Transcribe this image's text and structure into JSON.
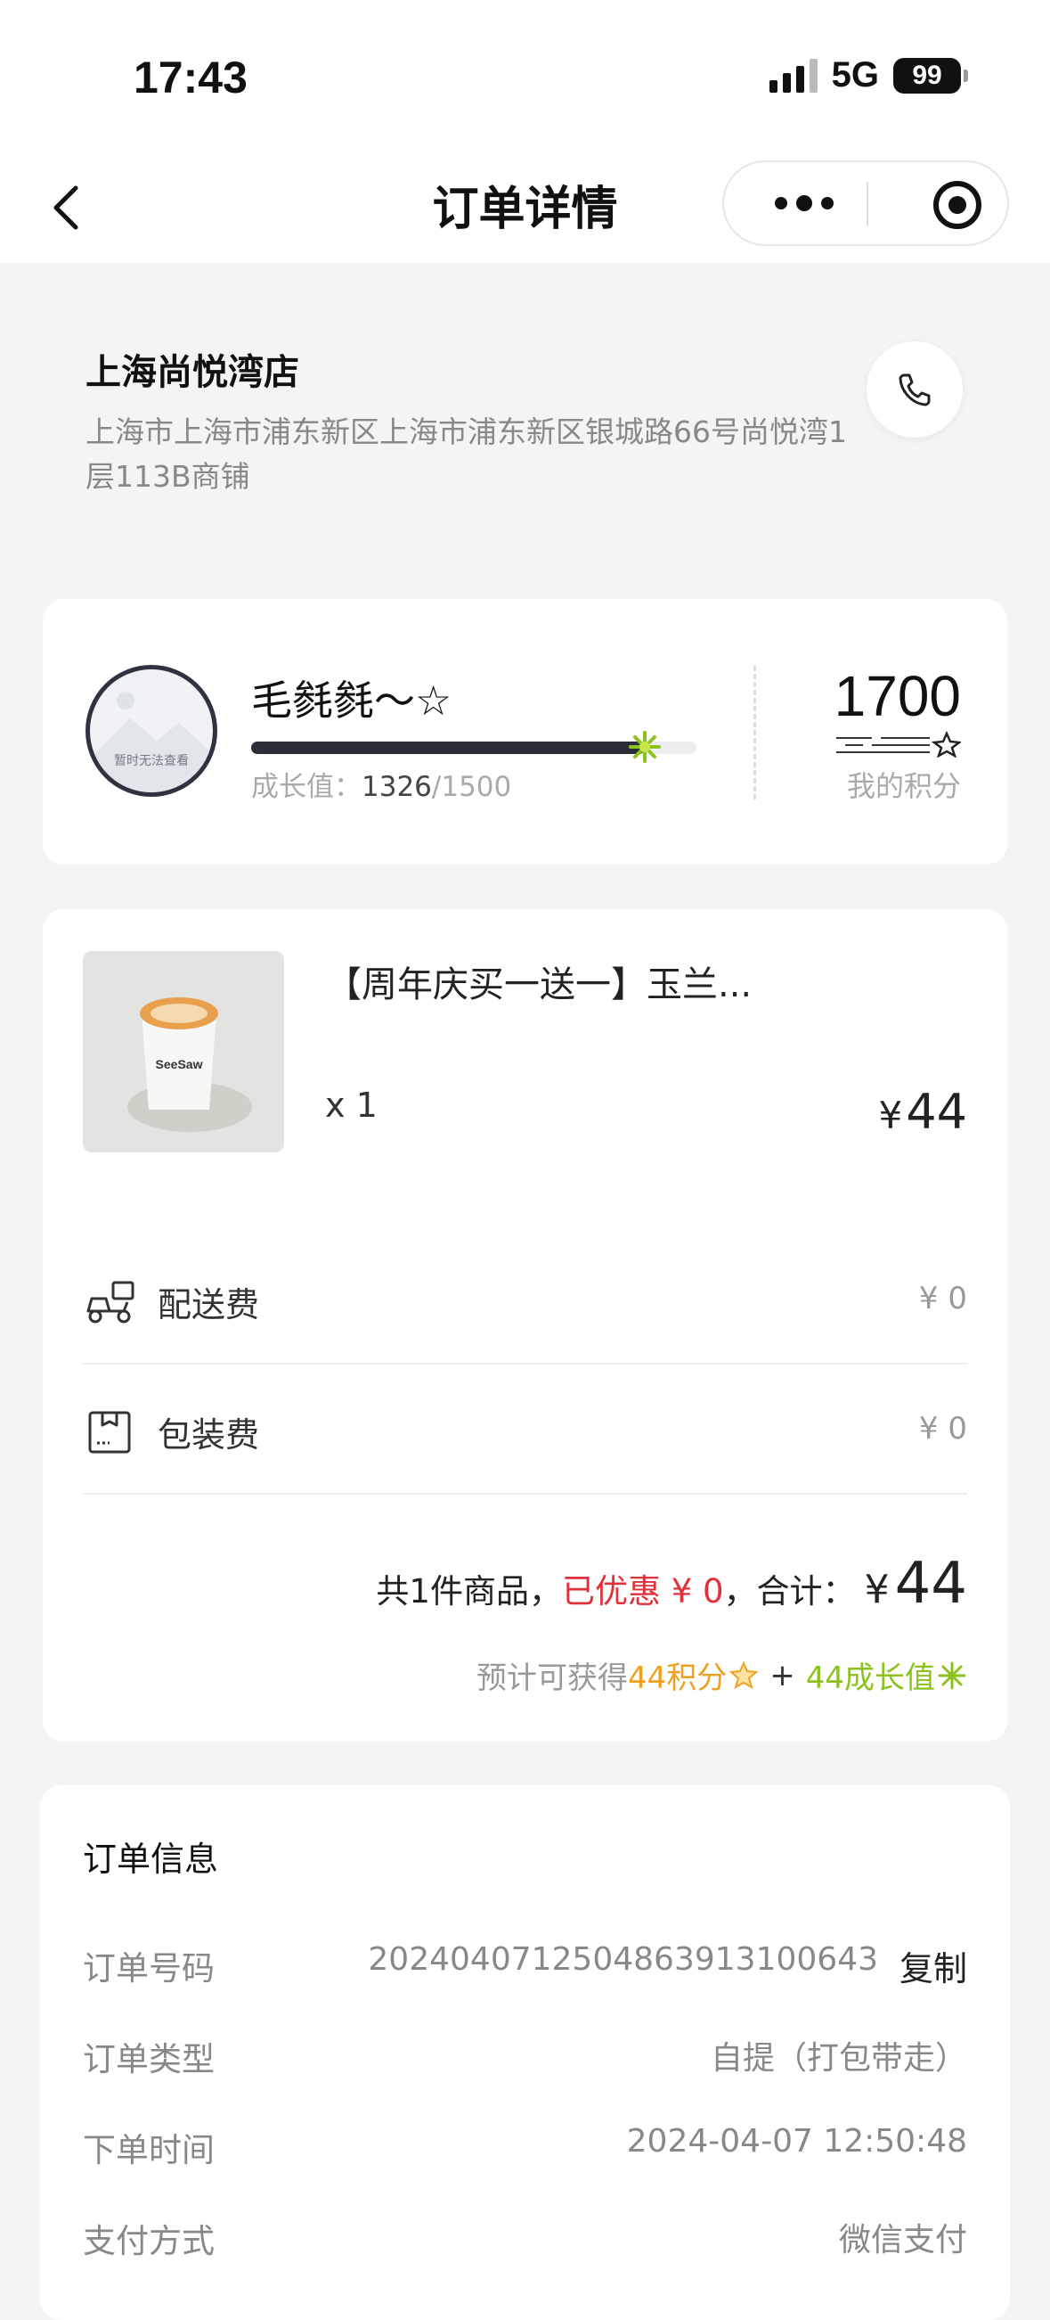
{
  "status_bar": {
    "time": "17:43",
    "network": "5G",
    "battery": "99"
  },
  "nav": {
    "title": "订单详情"
  },
  "store": {
    "name": "上海尚悦湾店",
    "address": "上海市上海市浦东新区上海市浦东新区银城路66号尚悦湾1层113B商铺"
  },
  "member": {
    "avatar_placeholder": "暂时无法查看",
    "nickname": "毛毵毵～☆",
    "growth_label": "成长值：",
    "growth_current": "1326",
    "growth_target": "/1500",
    "growth_progress": 0.884,
    "points": "1700",
    "points_label": "我的积分"
  },
  "order": {
    "product_name": "【周年庆买一送一】玉兰...",
    "quantity": "x 1",
    "price_symbol": "¥",
    "price": "44",
    "fees": [
      {
        "icon": "scooter-icon",
        "label": "配送费",
        "value": "¥ 0"
      },
      {
        "icon": "package-box-icon",
        "label": "包装费",
        "value": "¥ 0"
      }
    ],
    "summary_prefix": "共1件商品，",
    "discount_text": "已优惠 ¥ 0",
    "summary_mid": "，合计：",
    "total_symbol": "¥",
    "total": "44",
    "earn_prefix": "预计可获得 ",
    "earn_points": "44积分",
    "earn_plus": "+",
    "earn_growth": "44成长值",
    "colors": {
      "discount": "#e0303a",
      "points": "#f0a020",
      "growth": "#8cc21e"
    }
  },
  "info": {
    "title": "订单信息",
    "rows": [
      {
        "label": "订单号码",
        "value": "20240407125048639131006​43"
      },
      {
        "label": "订单类型",
        "value": "自提（打包带走）"
      },
      {
        "label": "下单时间",
        "value": "2024-04-07 12:50:48"
      },
      {
        "label": "支付方式",
        "value": "微信支付"
      }
    ],
    "copy_label": "复制"
  }
}
